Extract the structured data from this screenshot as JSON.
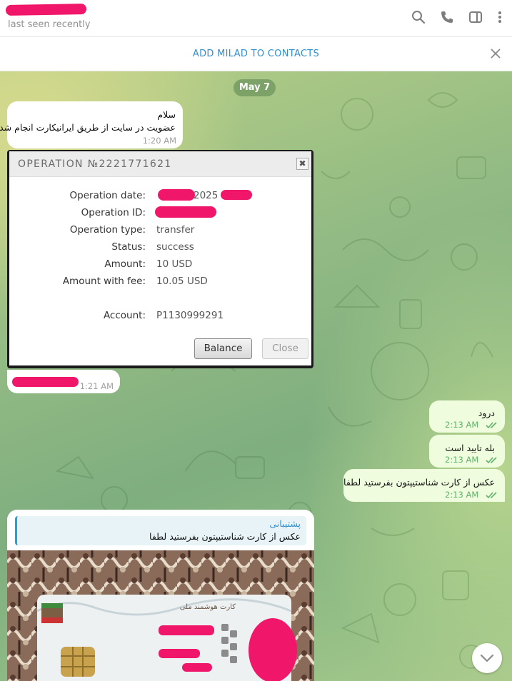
{
  "header": {
    "status": "last seen recently"
  },
  "banner": {
    "add_label": "ADD MILAD TO CONTACTS"
  },
  "date_chip": "May 7",
  "messages": [
    {
      "dir": "in",
      "line1": "سلام",
      "line2": "عضویت در سایت از طریق ایرانیکارت انجام شد",
      "time": "1:20 AM"
    },
    {
      "dir": "in",
      "time": "1:21 AM"
    },
    {
      "dir": "out",
      "text": "درود",
      "time": "2:13 AM"
    },
    {
      "dir": "out",
      "text": "بله تایید است",
      "time": "2:13 AM"
    },
    {
      "dir": "out",
      "text": "عکس از کارت شناستیپتون بفرستید لطفا",
      "time": "2:13 AM"
    }
  ],
  "operation": {
    "title": "OPERATION №2221771621",
    "close_glyph": "✖",
    "fields": [
      {
        "label": "Operation date:",
        "value": "2025"
      },
      {
        "label": "Operation ID:",
        "value": ""
      },
      {
        "label": "Operation type:",
        "value": "transfer"
      },
      {
        "label": "Status:",
        "value": "success"
      },
      {
        "label": "Amount:",
        "value": "10 USD"
      },
      {
        "label": "Amount with fee:",
        "value": "10.05 USD"
      },
      {
        "label": "Account:",
        "value": "P1130999291"
      }
    ],
    "balance_btn": "Balance",
    "close_btn": "Close"
  },
  "photo_msg": {
    "reply_name": "پشتیبانی",
    "reply_text": "عکس از کارت شناستیپتون بفرستید لطفا",
    "card_text": "کارت هوشمند ملی"
  },
  "colors": {
    "accent": "#2f8fd0",
    "redaction": "#f0176a",
    "outgoing": "#effdde",
    "read_check": "#5fb36a"
  }
}
